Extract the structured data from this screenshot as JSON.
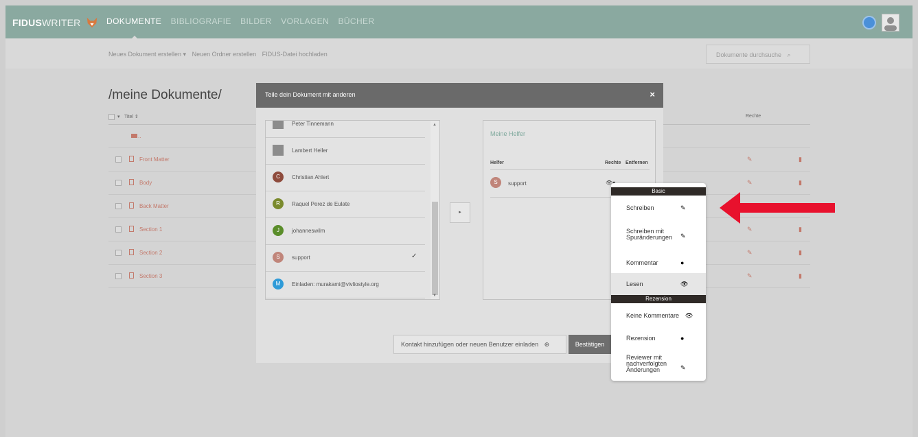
{
  "brand": {
    "bold": "FIDUS",
    "light": "WRITER"
  },
  "nav": {
    "items": [
      "DOKUMENTE",
      "BIBLIOGRAFIE",
      "BILDER",
      "VORLAGEN",
      "BÜCHER"
    ]
  },
  "subnav": {
    "new_document": "Neues Dokument erstellen ▾",
    "new_folder": "Neuen Ordner erstellen",
    "upload": "FIDUS-Datei hochladen",
    "search_placeholder": "Dokumente durchsuche"
  },
  "list": {
    "title": "/meine Dokumente/",
    "col_title": "Titel ⇕",
    "col_rights": "Rechte",
    "parent_folder": "..",
    "documents": [
      "Front Matter",
      "Body",
      "Back Matter",
      "Section 1",
      "Section 2",
      "Section 3"
    ]
  },
  "dialog": {
    "title": "Teile dein Dokument mit anderen",
    "close": "×",
    "contacts": [
      {
        "name": "Peter Tinnemann",
        "initial": "",
        "color": "#8c8c8c",
        "checked": false
      },
      {
        "name": "Lambert Heller",
        "initial": "",
        "color": "#8c8c8c",
        "checked": false
      },
      {
        "name": "Christian Ahlert",
        "initial": "C",
        "color": "#8e4b3c",
        "checked": false
      },
      {
        "name": "Raquel Perez de Eulate",
        "initial": "R",
        "color": "#7a8a2d",
        "checked": false
      },
      {
        "name": "johanneswilm",
        "initial": "J",
        "color": "#5a8d2a",
        "checked": false
      },
      {
        "name": "support",
        "initial": "S",
        "color": "#c0857a",
        "checked": true
      },
      {
        "name": "Einladen: murakami@vivliostyle.org",
        "initial": "M",
        "color": "#2f9bd8",
        "checked": false
      }
    ],
    "move_button": "▸",
    "helpers": {
      "title": "Meine Helfer",
      "col_helper": "Helfer",
      "col_rights": "Rechte",
      "col_remove": "Entfernen",
      "rows": [
        {
          "name": "support",
          "initial": "S",
          "rights_icon": "👁▾"
        }
      ]
    },
    "add_contact": "Kontakt hinzufügen oder neuen Benutzer einladen",
    "confirm": "Bestätigen"
  },
  "rights_menu": {
    "sections": [
      "Basic",
      "Rezension"
    ],
    "items": [
      {
        "label": "Schreiben",
        "icon": "✎",
        "icon_name": "pencil-icon",
        "selected": false
      },
      {
        "label": "Schreiben mit Spuränderungen",
        "icon": "✎",
        "icon_name": "pencil-icon",
        "selected": false
      },
      {
        "label": "Kommentar",
        "icon": "●",
        "icon_name": "comment-icon",
        "selected": false
      },
      {
        "label": "Lesen",
        "icon": "👁",
        "icon_name": "eye-icon",
        "selected": true
      },
      {
        "label": "Keine Kommentare",
        "icon": "👁",
        "icon_name": "eye-icon",
        "selected": false
      },
      {
        "label": "Rezension",
        "icon": "●",
        "icon_name": "comment-icon",
        "selected": false
      },
      {
        "label": "Reviewer mit nachverfolgten Änderungen",
        "icon": "✎",
        "icon_name": "pencil-icon",
        "selected": false
      }
    ]
  },
  "colors": {
    "accent": "#8aa9a0",
    "link": "#c3796b",
    "arrow": "#e8112d",
    "menu_header": "#2f2a27"
  }
}
